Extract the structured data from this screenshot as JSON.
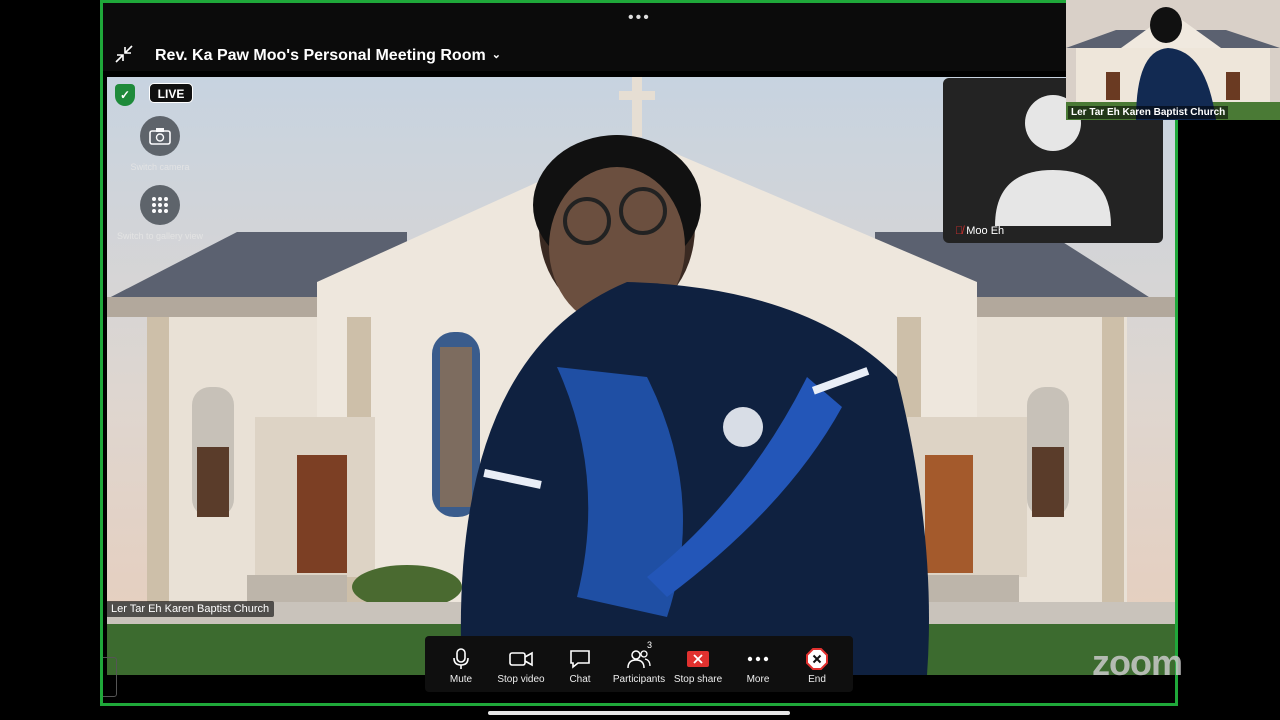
{
  "window": {
    "title": "Rev. Ka Paw Moo's Personal Meeting Room",
    "menu_dots": "•••"
  },
  "status": {
    "live_badge": "LIVE"
  },
  "side_controls": {
    "switch_camera": "Switch camera",
    "gallery_view": "Switch to gallery view"
  },
  "main_video": {
    "participant_name": "Ler Tar Eh Karen Baptist Church"
  },
  "thumbnail": {
    "participant_name": "Moo Eh"
  },
  "corner_video": {
    "participant_name": "Ler Tar Eh Karen Baptist Church"
  },
  "toolbar": {
    "mute": "Mute",
    "stop_video": "Stop video",
    "chat": "Chat",
    "participants": "Participants",
    "participants_count": "3",
    "stop_share": "Stop share",
    "more": "More",
    "end": "End"
  },
  "branding": {
    "logo_text": "zoom"
  },
  "icons": {
    "collapse": "collapse-icon",
    "shield": "shield-icon",
    "camera_switch": "camera-switch-icon",
    "grid": "grid-icon",
    "mic": "mic-icon",
    "video": "video-icon",
    "chat": "chat-icon",
    "participants": "participants-icon",
    "share": "share-icon",
    "more": "more-icon",
    "end": "end-icon"
  },
  "colors": {
    "active_border": "#1fa83a",
    "share_red": "#e0312f",
    "end_red": "#e0312f"
  }
}
